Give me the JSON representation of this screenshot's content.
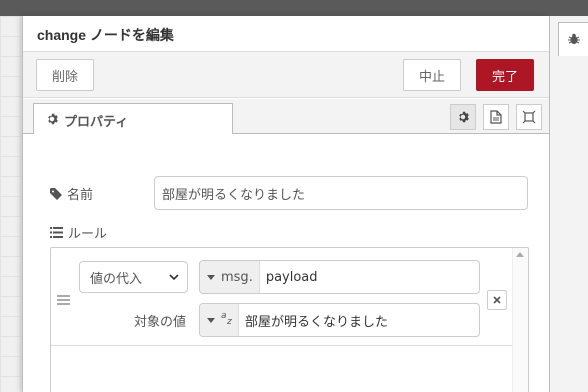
{
  "editor": {
    "title": "change ノードを編集",
    "delete_label": "削除",
    "cancel_label": "中止",
    "done_label": "完了",
    "accent_color": "#ad1625"
  },
  "tabs": {
    "properties_label": "プロパティ",
    "properties_icon": "gear-icon",
    "side_icons": [
      "gear-icon",
      "description-icon",
      "appearance-icon"
    ]
  },
  "form": {
    "name_label": "名前",
    "name_value": "部屋が明るくなりました",
    "rules_label": "ルール"
  },
  "rule": {
    "action": "値の代入",
    "property_type": "msg.",
    "property_value": "payload",
    "to_label": "対象の値",
    "to_type_icon": "string-type-icon",
    "to_value": "部屋が明るくなりました"
  }
}
